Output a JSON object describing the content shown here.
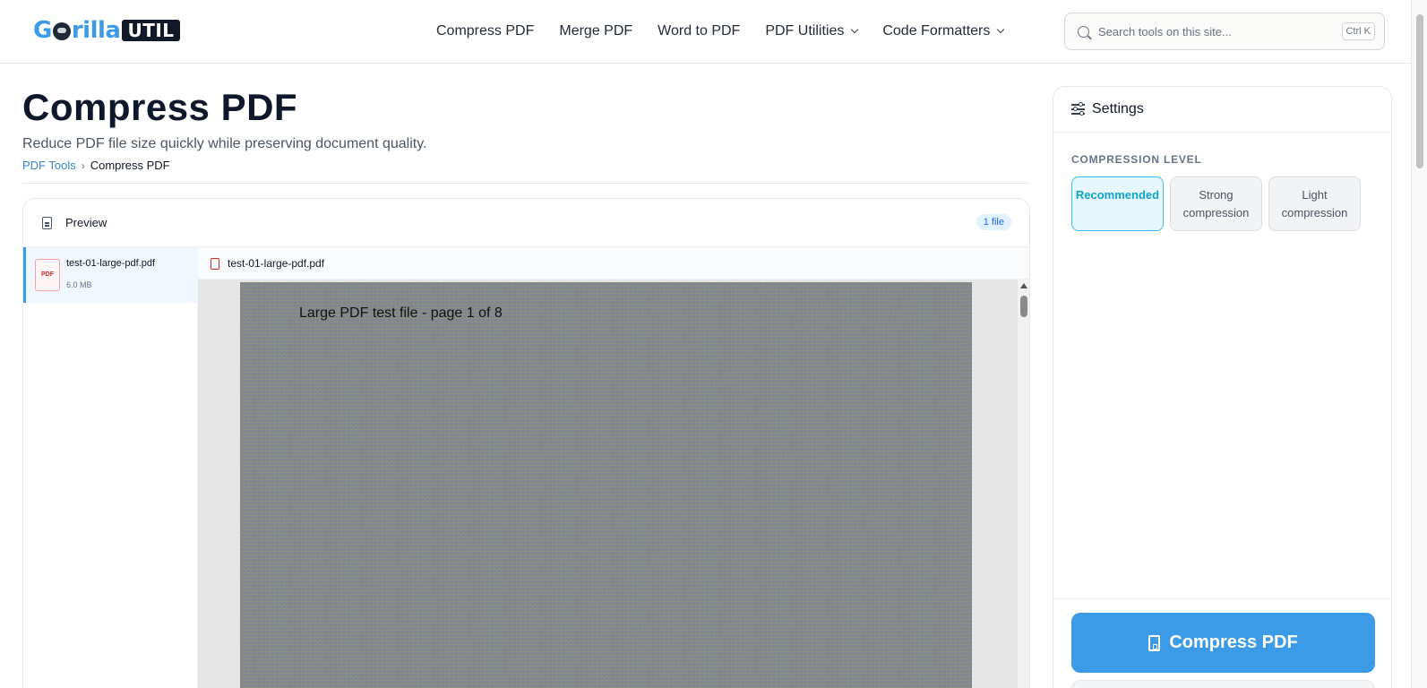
{
  "brand": {
    "logo_prefix": "G",
    "logo_middle": "rilla",
    "logo_badge": "UTIL",
    "accent_color": "#3b9be6"
  },
  "nav": {
    "items": [
      {
        "label": "Compress PDF"
      },
      {
        "label": "Merge PDF"
      },
      {
        "label": "Word to PDF"
      },
      {
        "label": "PDF Utilities"
      },
      {
        "label": "Code Formatters"
      }
    ]
  },
  "search": {
    "placeholder": "Search tools on this site...",
    "shortcut": "Ctrl K"
  },
  "page": {
    "title": "Compress PDF",
    "subtitle": "Reduce PDF file size quickly while preserving document quality.",
    "breadcrumb": {
      "parent": "PDF Tools",
      "separator": "›",
      "current": "Compress PDF"
    }
  },
  "preview": {
    "label": "Preview",
    "file_count": "1 file",
    "files": [
      {
        "thumb": "PDF",
        "name": "test-01-large-pdf.pdf",
        "size": "6.0 MB"
      }
    ],
    "viewer_filename": "test-01-large-pdf.pdf",
    "page_text": "Large PDF test file - page 1 of 8"
  },
  "settings": {
    "title": "Settings",
    "section_label": "COMPRESSION LEVEL",
    "levels": [
      {
        "label": "Recommended",
        "selected": true
      },
      {
        "label": "Strong compression",
        "selected": false
      },
      {
        "label": "Light compression",
        "selected": false
      }
    ],
    "action_label": "Compress PDF"
  }
}
